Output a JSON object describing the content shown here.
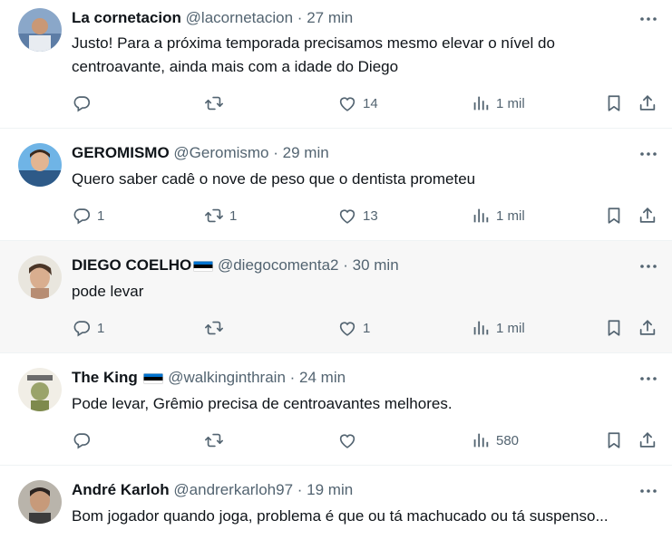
{
  "tweets": [
    {
      "name": "La cornetacion",
      "handle": "@lacornetacion",
      "separator": "·",
      "time": "27 min",
      "text": "Justo! Para a próxima temporada precisamos mesmo elevar o nível do centroavante, ainda mais com a idade do Diego",
      "replies": "",
      "retweets": "",
      "likes": "14",
      "views": "1 mil",
      "flag": false
    },
    {
      "name": "GEROMISMO",
      "handle": "@Geromismo",
      "separator": "·",
      "time": "29 min",
      "text": "Quero saber cadê o nove de peso que o dentista prometeu",
      "replies": "1",
      "retweets": "1",
      "likes": "13",
      "views": "1 mil",
      "flag": false
    },
    {
      "name": "DIEGO COELHO",
      "handle": "@diegocomenta2",
      "separator": "·",
      "time": "30 min",
      "text": "pode levar",
      "replies": "1",
      "retweets": "",
      "likes": "1",
      "views": "1 mil",
      "flag": true
    },
    {
      "name": "The King",
      "handle": "@walkinginthrain",
      "separator": "·",
      "time": "24 min",
      "text": "Pode levar, Grêmio precisa de centroavantes melhores.",
      "replies": "",
      "retweets": "",
      "likes": "",
      "views": "580",
      "flag": true
    },
    {
      "name": "André Karloh",
      "handle": "@andrerkarloh97",
      "separator": "·",
      "time": "19 min",
      "text": "Bom jogador quando joga, problema é que ou tá machucado ou tá suspenso...",
      "flag": false
    }
  ],
  "icons": {
    "reply": "reply-icon",
    "retweet": "retweet-icon",
    "like": "heart-icon",
    "views": "views-icon",
    "bookmark": "bookmark-icon",
    "share": "share-icon",
    "more": "more-icon"
  },
  "colors": {
    "text": "#0f1419",
    "secondary": "#536471",
    "highlight_bg": "#f7f7f7",
    "divider": "#eff3f4",
    "flag_blue": "#0072ce",
    "flag_black": "#000000",
    "flag_white": "#ffffff"
  }
}
